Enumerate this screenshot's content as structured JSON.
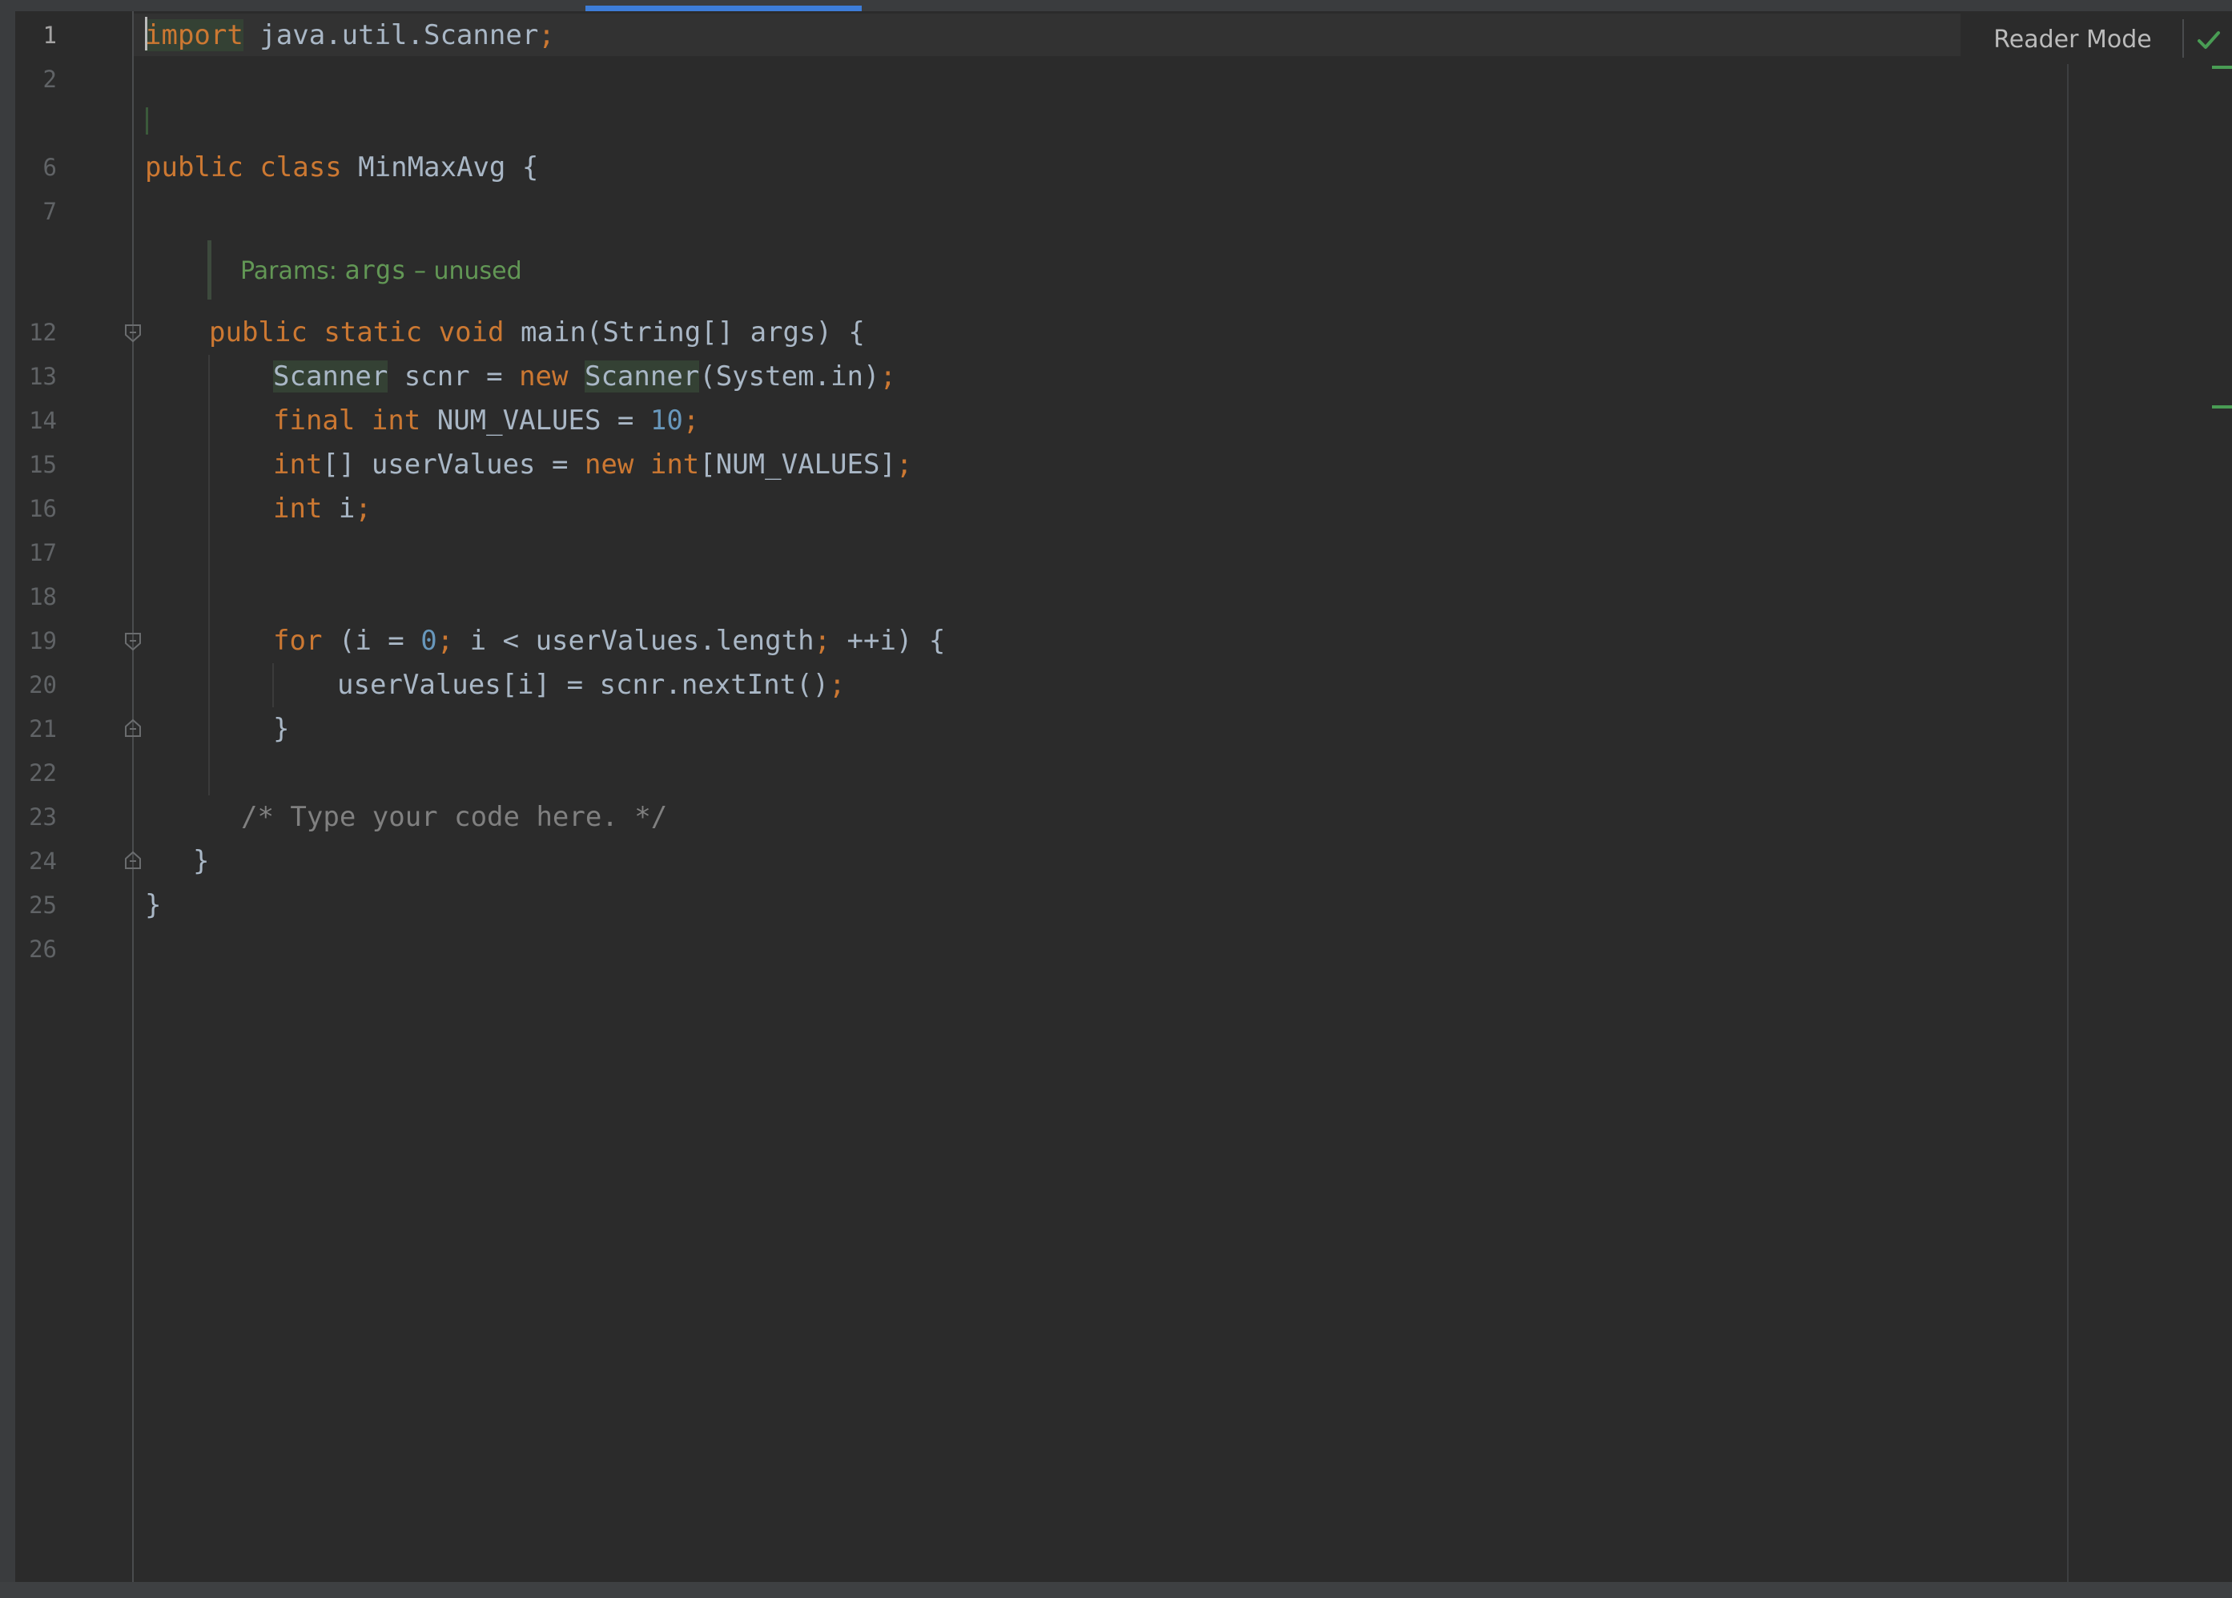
{
  "editor": {
    "reader_mode_label": "Reader Mode",
    "line_numbers": [
      "1",
      "2",
      "6",
      "7",
      "12",
      "13",
      "14",
      "15",
      "16",
      "17",
      "18",
      "19",
      "20",
      "21",
      "22",
      "23",
      "24",
      "25",
      "26"
    ],
    "code": {
      "import_kw": "import",
      "import_path": " java.util.Scanner",
      "semicolon": ";",
      "public_kw": "public",
      "class_kw": "class",
      "class_name": "MinMaxAvg {",
      "static_kw": "static",
      "void_kw": "void",
      "main_sig": "main(String[] args) {",
      "scanner_type": "Scanner",
      "scnr_decl": " scnr = ",
      "new_kw": "new",
      "scanner_ctor": "Scanner",
      "system_in": "(System.in)",
      "final_kw": "final",
      "int_kw": "int",
      "num_values_decl": " NUM_VALUES = ",
      "ten": "10",
      "array_brackets": "[] userValues = ",
      "array_size": "[NUM_VALUES]",
      "i_decl": " i",
      "for_kw": "for",
      "for_open": " (i = ",
      "zero": "0",
      "for_cond": " i < userValues.length",
      "for_incr": " ++i) {",
      "loop_body": "userValues[i] = scnr.nextInt()",
      "close_brace": "}",
      "comment": "/* Type your code here. */"
    },
    "param_hint": {
      "prefix": "Params: ",
      "name": "args",
      "suffix": " – unused"
    },
    "colors": {
      "background": "#2b2b2b",
      "keyword": "#cc7832",
      "number": "#6897bb",
      "comment": "#808080",
      "hint": "#629755",
      "ok": "#499c54"
    }
  }
}
